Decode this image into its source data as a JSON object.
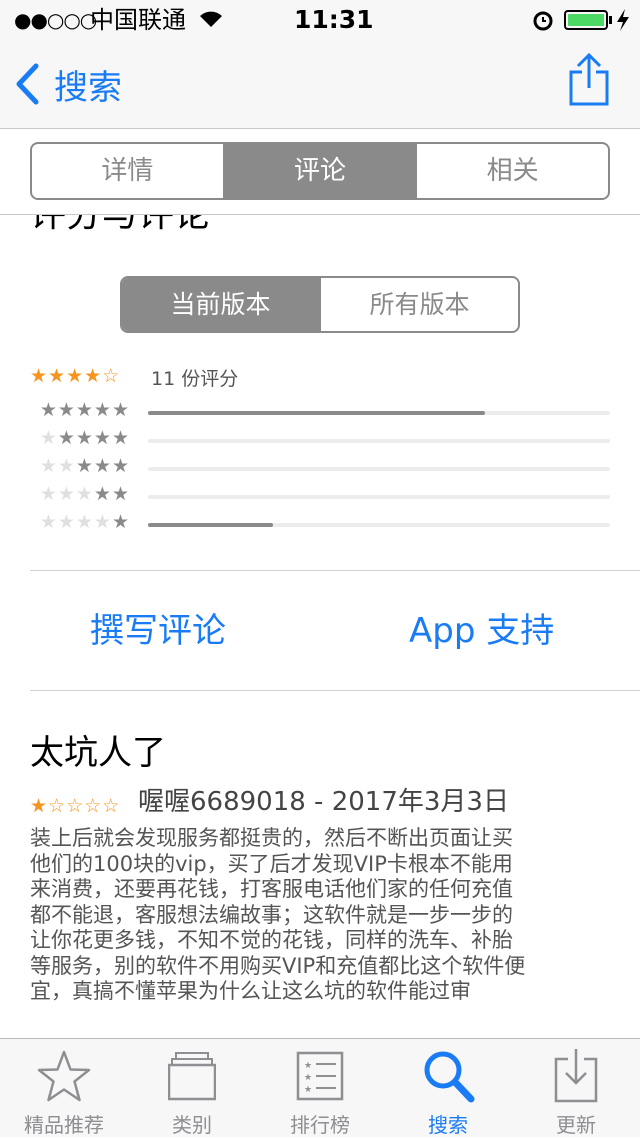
{
  "status_bar": {
    "signal": "●●○○○",
    "carrier": "中国联通",
    "time": "11:31"
  },
  "nav": {
    "back_label": "搜索"
  },
  "top_tabs": [
    "详情",
    "评论",
    "相关"
  ],
  "section_title": "评分与评论",
  "version_tabs": [
    "当前版本",
    "所有版本"
  ],
  "ratings": {
    "average_stars": "★★★★☆",
    "count_label": "11 份评分",
    "rows": [
      {
        "stars": "★★★★★",
        "fraction": 0.73
      },
      {
        "stars": "★★★★",
        "fraction": 0
      },
      {
        "stars": "★★★",
        "fraction": 0
      },
      {
        "stars": "★★",
        "fraction": 0
      },
      {
        "stars": "★",
        "fraction": 0.27
      }
    ]
  },
  "actions": {
    "write_review": "撰写评论",
    "app_support": "App 支持"
  },
  "review": {
    "title": "太坑人了",
    "stars": "★☆☆☆☆",
    "author_date": "喔喔6689018 - 2017年3月3日",
    "body_lines": [
      "装上后就会发现服务都挺贵的，然后不断出页面让买",
      "他们的100块的vip，买了后才发现VIP卡根本不能用",
      "来消费，还要再花钱，打客服电话他们家的任何充值",
      "都不能退，客服想法编故事；这软件就是一步一步的",
      "让你花更多钱，不知不觉的花钱，同样的洗车、补胎",
      "等服务，别的软件不用购买VIP和充值都比这个软件便",
      "宜，真搞不懂苹果为什么让这么坑的软件能过审"
    ]
  },
  "tab_bar": [
    {
      "label": "精品推荐",
      "icon": "star-icon"
    },
    {
      "label": "类别",
      "icon": "categories-icon"
    },
    {
      "label": "排行榜",
      "icon": "list-icon"
    },
    {
      "label": "搜索",
      "icon": "search-icon",
      "active": true
    },
    {
      "label": "更新",
      "icon": "updates-icon"
    }
  ],
  "colors": {
    "accent": "#1a7cf5",
    "segment": "#8a8a8a",
    "star_orange": "#f7941d",
    "battery": "#4cd964"
  }
}
